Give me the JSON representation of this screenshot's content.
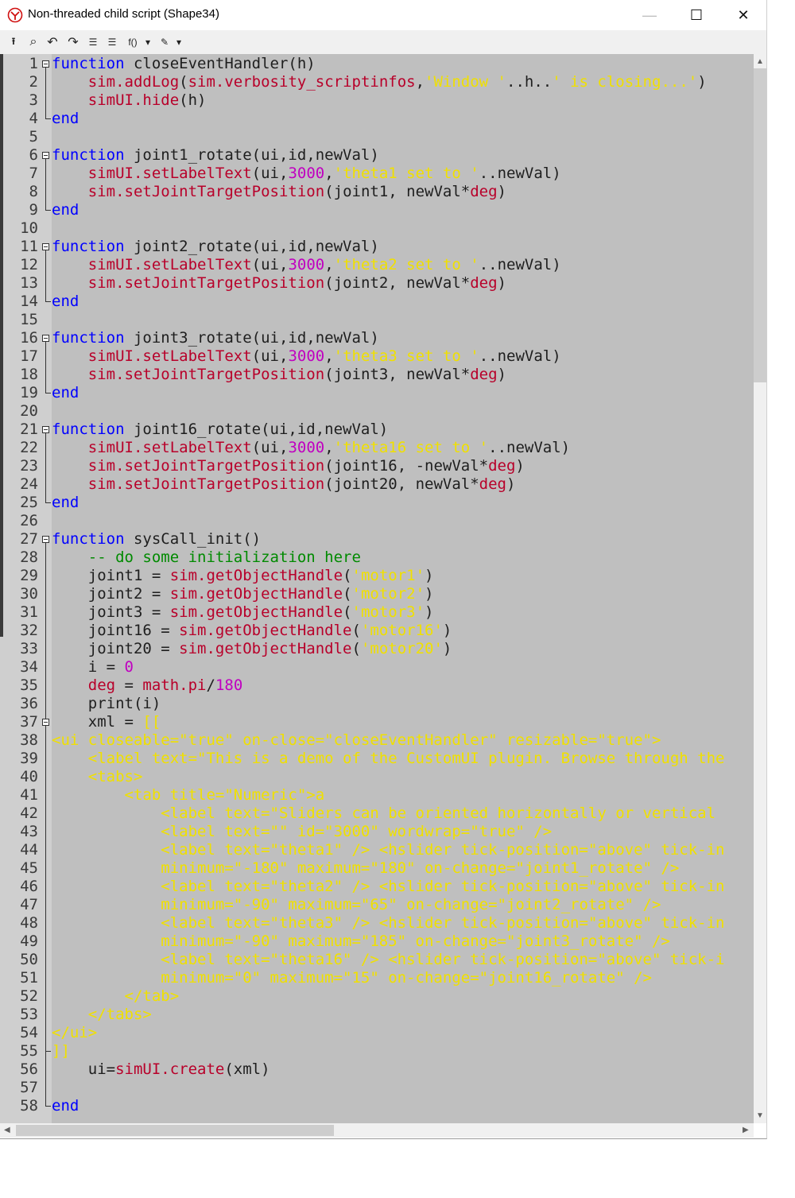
{
  "window": {
    "title": "Non-threaded child script (Shape34)",
    "minimize_glyph": "—",
    "maximize_glyph": "☐",
    "close_glyph": "✕"
  },
  "toolbar": {
    "items": [
      {
        "name": "upload-icon",
        "glyph": "⭱"
      },
      {
        "name": "search-icon",
        "glyph": "⌕"
      },
      {
        "name": "undo-icon",
        "glyph": "↶"
      },
      {
        "name": "redo-icon",
        "glyph": "↷"
      },
      {
        "name": "indent-icon",
        "glyph": "☰"
      },
      {
        "name": "unindent-icon",
        "glyph": "☰"
      },
      {
        "name": "functions-menu",
        "glyph": "f()"
      },
      {
        "name": "dropdown-icon",
        "glyph": "▾"
      },
      {
        "name": "snippets-icon",
        "glyph": "✎"
      },
      {
        "name": "dropdown-icon",
        "glyph": "▾"
      }
    ]
  },
  "colors": {
    "keyword": "#0000ff",
    "function_name": "#b8002a",
    "string": "#f0e000",
    "number": "#c000c0",
    "comment": "#008a00",
    "background": "#bfbfbf"
  },
  "code_lines": [
    [
      [
        "kw",
        "function"
      ],
      [
        "t",
        " closeEventHandler(h)"
      ]
    ],
    [
      [
        "t",
        "    "
      ],
      [
        "fn",
        "sim.addLog"
      ],
      [
        "t",
        "("
      ],
      [
        "fn",
        "sim.verbosity_scriptinfos"
      ],
      [
        "t",
        ","
      ],
      [
        "str",
        "'Window '"
      ],
      [
        "t",
        "..h.."
      ],
      [
        "str",
        "' is closing...'"
      ],
      [
        "t",
        ")"
      ]
    ],
    [
      [
        "t",
        "    "
      ],
      [
        "fn",
        "simUI.hide"
      ],
      [
        "t",
        "(h)"
      ]
    ],
    [
      [
        "kw",
        "end"
      ]
    ],
    [],
    [
      [
        "kw",
        "function"
      ],
      [
        "t",
        " joint1_rotate(ui,id,newVal)"
      ]
    ],
    [
      [
        "t",
        "    "
      ],
      [
        "fn",
        "simUI.setLabelText"
      ],
      [
        "t",
        "(ui,"
      ],
      [
        "num",
        "3000"
      ],
      [
        "t",
        ","
      ],
      [
        "str",
        "'theta1 set to '"
      ],
      [
        "t",
        "..newVal)"
      ]
    ],
    [
      [
        "t",
        "    "
      ],
      [
        "fn",
        "sim.setJointTargetPosition"
      ],
      [
        "t",
        "(joint1, newVal*"
      ],
      [
        "fn",
        "deg"
      ],
      [
        "t",
        ")"
      ]
    ],
    [
      [
        "kw",
        "end"
      ]
    ],
    [],
    [
      [
        "kw",
        "function"
      ],
      [
        "t",
        " joint2_rotate(ui,id,newVal)"
      ]
    ],
    [
      [
        "t",
        "    "
      ],
      [
        "fn",
        "simUI.setLabelText"
      ],
      [
        "t",
        "(ui,"
      ],
      [
        "num",
        "3000"
      ],
      [
        "t",
        ","
      ],
      [
        "str",
        "'theta2 set to '"
      ],
      [
        "t",
        "..newVal)"
      ]
    ],
    [
      [
        "t",
        "    "
      ],
      [
        "fn",
        "sim.setJointTargetPosition"
      ],
      [
        "t",
        "(joint2, newVal*"
      ],
      [
        "fn",
        "deg"
      ],
      [
        "t",
        ")"
      ]
    ],
    [
      [
        "kw",
        "end"
      ]
    ],
    [],
    [
      [
        "kw",
        "function"
      ],
      [
        "t",
        " joint3_rotate(ui,id,newVal)"
      ]
    ],
    [
      [
        "t",
        "    "
      ],
      [
        "fn",
        "simUI.setLabelText"
      ],
      [
        "t",
        "(ui,"
      ],
      [
        "num",
        "3000"
      ],
      [
        "t",
        ","
      ],
      [
        "str",
        "'theta3 set to '"
      ],
      [
        "t",
        "..newVal)"
      ]
    ],
    [
      [
        "t",
        "    "
      ],
      [
        "fn",
        "sim.setJointTargetPosition"
      ],
      [
        "t",
        "(joint3, newVal*"
      ],
      [
        "fn",
        "deg"
      ],
      [
        "t",
        ")"
      ]
    ],
    [
      [
        "kw",
        "end"
      ]
    ],
    [],
    [
      [
        "kw",
        "function"
      ],
      [
        "t",
        " joint16_rotate(ui,id,newVal)"
      ]
    ],
    [
      [
        "t",
        "    "
      ],
      [
        "fn",
        "simUI.setLabelText"
      ],
      [
        "t",
        "(ui,"
      ],
      [
        "num",
        "3000"
      ],
      [
        "t",
        ","
      ],
      [
        "str",
        "'theta16 set to '"
      ],
      [
        "t",
        "..newVal)"
      ]
    ],
    [
      [
        "t",
        "    "
      ],
      [
        "fn",
        "sim.setJointTargetPosition"
      ],
      [
        "t",
        "(joint16, -newVal*"
      ],
      [
        "fn",
        "deg"
      ],
      [
        "t",
        ")"
      ]
    ],
    [
      [
        "t",
        "    "
      ],
      [
        "fn",
        "sim.setJointTargetPosition"
      ],
      [
        "t",
        "(joint20, newVal*"
      ],
      [
        "fn",
        "deg"
      ],
      [
        "t",
        ")"
      ]
    ],
    [
      [
        "kw",
        "end"
      ]
    ],
    [],
    [
      [
        "kw",
        "function"
      ],
      [
        "t",
        " sysCall_init()"
      ]
    ],
    [
      [
        "cm",
        "    -- do some initialization here"
      ]
    ],
    [
      [
        "t",
        "    joint1 = "
      ],
      [
        "fn",
        "sim.getObjectHandle"
      ],
      [
        "t",
        "("
      ],
      [
        "str",
        "'motor1'"
      ],
      [
        "t",
        ")"
      ]
    ],
    [
      [
        "t",
        "    joint2 = "
      ],
      [
        "fn",
        "sim.getObjectHandle"
      ],
      [
        "t",
        "("
      ],
      [
        "str",
        "'motor2'"
      ],
      [
        "t",
        ")"
      ]
    ],
    [
      [
        "t",
        "    joint3 = "
      ],
      [
        "fn",
        "sim.getObjectHandle"
      ],
      [
        "t",
        "("
      ],
      [
        "str",
        "'motor3'"
      ],
      [
        "t",
        ")"
      ]
    ],
    [
      [
        "t",
        "    joint16 = "
      ],
      [
        "fn",
        "sim.getObjectHandle"
      ],
      [
        "t",
        "("
      ],
      [
        "str",
        "'motor16'"
      ],
      [
        "t",
        ")"
      ]
    ],
    [
      [
        "t",
        "    joint20 = "
      ],
      [
        "fn",
        "sim.getObjectHandle"
      ],
      [
        "t",
        "("
      ],
      [
        "str",
        "'motor20'"
      ],
      [
        "t",
        ")"
      ]
    ],
    [
      [
        "t",
        "    i = "
      ],
      [
        "num",
        "0"
      ]
    ],
    [
      [
        "t",
        "    "
      ],
      [
        "fn",
        "deg"
      ],
      [
        "t",
        " = "
      ],
      [
        "fn",
        "math.pi"
      ],
      [
        "t",
        "/"
      ],
      [
        "num",
        "180"
      ]
    ],
    [
      [
        "t",
        "    print(i)"
      ]
    ],
    [
      [
        "t",
        "    xml = "
      ],
      [
        "xml",
        "[["
      ]
    ],
    [
      [
        "xml",
        "<ui closeable=\"true\" on-close=\"closeEventHandler\" resizable=\"true\">"
      ]
    ],
    [
      [
        "xml",
        "    <label text=\"This is a demo of the CustomUI plugin. Browse through the"
      ]
    ],
    [
      [
        "xml",
        "    <tabs>"
      ]
    ],
    [
      [
        "xml",
        "        <tab title=\"Numeric\">a"
      ]
    ],
    [
      [
        "xml",
        "            <label text=\"Sliders can be oriented horizontally or vertical"
      ]
    ],
    [
      [
        "xml",
        "            <label text=\"\" id=\"3000\" wordwrap=\"true\" />"
      ]
    ],
    [
      [
        "xml",
        "            <label text=\"theta1\" /> <hslider tick-position=\"above\" tick-in"
      ]
    ],
    [
      [
        "xml",
        "            minimum=\"-180\" maximum=\"180\" on-change=\"joint1_rotate\" />"
      ]
    ],
    [
      [
        "xml",
        "            <label text=\"theta2\" /> <hslider tick-position=\"above\" tick-in"
      ]
    ],
    [
      [
        "xml",
        "            minimum=\"-90\" maximum=\"65\" on-change=\"joint2_rotate\" />"
      ]
    ],
    [
      [
        "xml",
        "            <label text=\"theta3\" /> <hslider tick-position=\"above\" tick-in"
      ]
    ],
    [
      [
        "xml",
        "            minimum=\"-90\" maximum=\"185\" on-change=\"joint3_rotate\" />"
      ]
    ],
    [
      [
        "xml",
        "            <label text=\"theta16\" /> <hslider tick-position=\"above\" tick-i"
      ]
    ],
    [
      [
        "xml",
        "            minimum=\"0\" maximum=\"15\" on-change=\"joint16_rotate\" />"
      ]
    ],
    [
      [
        "xml",
        "        </tab>"
      ]
    ],
    [
      [
        "xml",
        "    </tabs>"
      ]
    ],
    [
      [
        "xml",
        "</ui>"
      ]
    ],
    [
      [
        "xml",
        "]]"
      ]
    ],
    [
      [
        "t",
        "    ui="
      ],
      [
        "fn",
        "simUI.create"
      ],
      [
        "t",
        "(xml)"
      ]
    ],
    [],
    [
      [
        "kw",
        "end"
      ]
    ]
  ]
}
